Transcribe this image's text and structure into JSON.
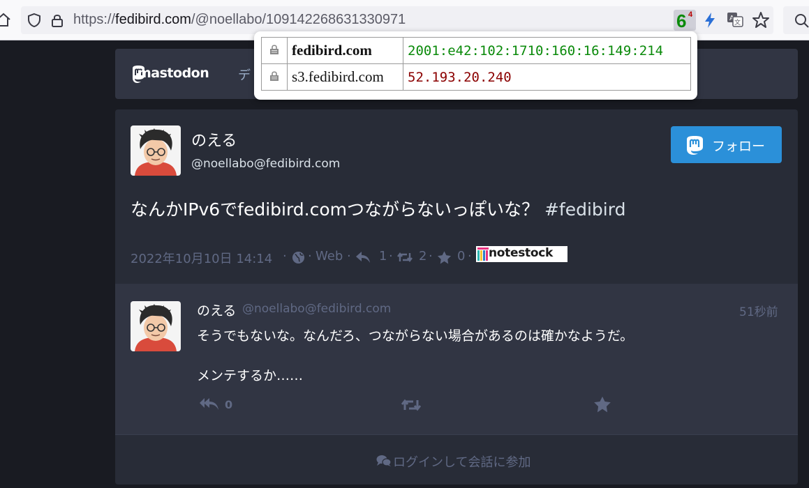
{
  "browser": {
    "url_prefix": "https://",
    "url_host": "fedibird.com",
    "url_path": "/@noellabo/109142268631330971",
    "ip_badge_main": "6",
    "ip_badge_sub": "4"
  },
  "ip_popup": {
    "rows": [
      {
        "host": "fedibird.com",
        "ip": "2001:e42:102:1710:160:16:149:214",
        "ip_color": "#0a8a0a"
      },
      {
        "host": "s3.fedibird.com",
        "ip": "52.193.20.240",
        "ip_color": "#8b0000"
      }
    ]
  },
  "header": {
    "logo_text": "mastodon",
    "nav_partial": "デ"
  },
  "status": {
    "display_name": "のえる",
    "account": "@noellabo@fedibird.com",
    "follow_label": "フォロー",
    "text": "なんかIPv6でfedibird.comつながらないっぽいな？",
    "hashtag": "#fedibird",
    "datetime": "2022年10月10日 14:14",
    "sep": "·",
    "application": "Web",
    "reply_count": "1",
    "boost_count": "2",
    "fav_count": "0",
    "notestock_label": "notestock"
  },
  "reply": {
    "display_name": "のえる",
    "account": "@noellabo@fedibird.com",
    "relative_time": "51秒前",
    "line1": "そうでもないな。なんだろ、つながらない場合があるのは確かなようだ。",
    "line2": "メンテするか……",
    "reply_count": "0"
  },
  "login_prompt": "ログインして会話に参加",
  "colors": {
    "background": "#191b22",
    "card": "#282c37",
    "reply_bg": "#313543",
    "accent": "#2b90d9",
    "muted": "#606984"
  }
}
